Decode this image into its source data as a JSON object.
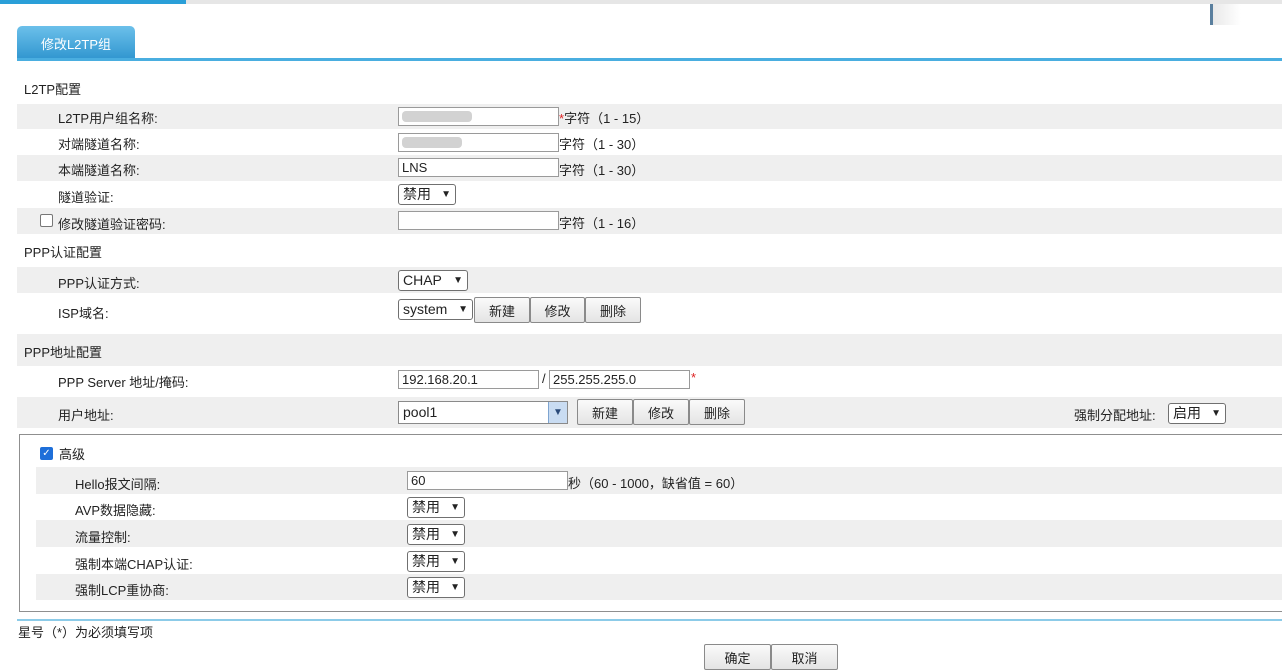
{
  "tab": {
    "label": "修改L2TP组"
  },
  "l2tp": {
    "title": "L2TP配置",
    "group_name": {
      "label": "L2TP用户组名称:",
      "value": "",
      "required_mark": "*",
      "hint": "字符（1 - 15）"
    },
    "peer_tunnel": {
      "label": "对端隧道名称:",
      "value": "",
      "hint": "字符（1 - 30）"
    },
    "local_tunnel": {
      "label": "本端隧道名称:",
      "value": "LNS",
      "hint": "字符（1 - 30）"
    },
    "tunnel_auth": {
      "label": "隧道验证:",
      "value": "禁用"
    },
    "change_password": {
      "label": "修改隧道验证密码:",
      "value": "",
      "hint": "字符（1 - 16）"
    }
  },
  "ppp_auth": {
    "title": "PPP认证配置",
    "method": {
      "label": "PPP认证方式:",
      "value": "CHAP"
    },
    "isp": {
      "label": "ISP域名:",
      "value": "system",
      "new": "新建",
      "edit": "修改",
      "delete": "删除"
    }
  },
  "ppp_addr": {
    "title": "PPP地址配置",
    "server": {
      "label": "PPP Server 地址/掩码:",
      "ip": "192.168.20.1",
      "sep": "/",
      "mask": "255.255.255.0",
      "required_mark": "*"
    },
    "user_addr": {
      "label": "用户地址:",
      "value": "pool1",
      "new": "新建",
      "edit": "修改",
      "delete": "删除"
    },
    "force_assign": {
      "label": "强制分配地址:",
      "value": "启用"
    }
  },
  "advanced": {
    "title": "高级",
    "hello": {
      "label": "Hello报文间隔:",
      "value": "60",
      "hint": "秒（60 - 1000，缺省值 = 60）"
    },
    "avp": {
      "label": "AVP数据隐藏:",
      "value": "禁用"
    },
    "flow": {
      "label": "流量控制:",
      "value": "禁用"
    },
    "chap": {
      "label": "强制本端CHAP认证:",
      "value": "禁用"
    },
    "lcp": {
      "label": "强制LCP重协商:",
      "value": "禁用"
    }
  },
  "footer": {
    "note": "星号（*）为必须填写项",
    "ok": "确定",
    "cancel": "取消"
  }
}
